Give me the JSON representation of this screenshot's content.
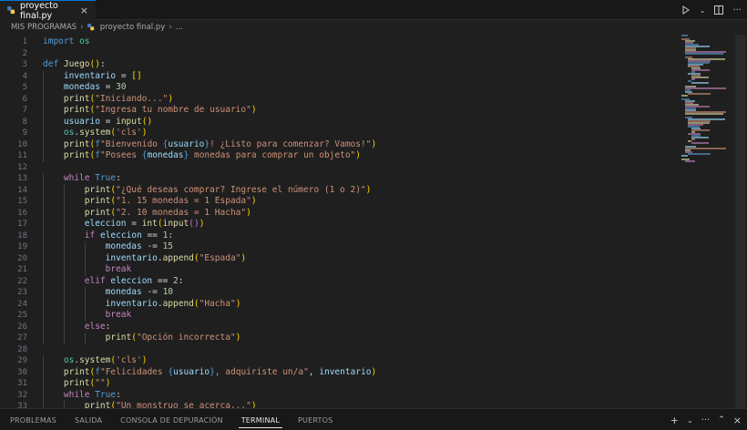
{
  "tab": {
    "filename": "proyecto final.py"
  },
  "breadcrumb": {
    "folder": "MIS PROGRAMAS",
    "file": "proyecto final.py",
    "more": "..."
  },
  "line_numbers": [
    "1",
    "2",
    "3",
    "4",
    "5",
    "6",
    "7",
    "8",
    "9",
    "10",
    "11",
    "12",
    "13",
    "14",
    "15",
    "16",
    "17",
    "18",
    "19",
    "20",
    "21",
    "22",
    "23",
    "24",
    "25",
    "26",
    "27",
    "28",
    "29",
    "30",
    "31",
    "32",
    "33"
  ],
  "code_lines": [
    "import os",
    "",
    "def Juego():",
    "    inventario = []",
    "    monedas = 30",
    "    print(\"Iniciando...\")",
    "    print(\"Ingresa tu nombre de usuario\")",
    "    usuario = input()",
    "    os.system('cls')",
    "    print(f\"Bienvenido {usuario}! ¿Listo para comenzar? Vamos!\")",
    "    print(f\"Posees {monedas} monedas para comprar un objeto\")",
    "",
    "    while True:",
    "        print(\"¿Qué deseas comprar? Ingrese el número (1 o 2)\")",
    "        print(\"1. 15 monedas = 1 Espada\")",
    "        print(\"2. 10 monedas = 1 Hacha\")",
    "        eleccion = int(input())",
    "        if eleccion == 1:",
    "            monedas -= 15",
    "            inventario.append(\"Espada\")",
    "            break",
    "        elif eleccion == 2:",
    "            monedas -= 10",
    "            inventario.append(\"Hacha\")",
    "            break",
    "        else:",
    "            print(\"Opción incorrecta\")",
    "",
    "    os.system('cls')",
    "    print(f\"Felicidades {usuario}, adquiriste un/a\", inventario)",
    "    print(\"\")",
    "    while True:",
    "        print(\"Un monstruo se acerca...\")"
  ],
  "panel": {
    "tabs": [
      "PROBLEMAS",
      "SALIDA",
      "CONSOLA DE DEPURACIÓN",
      "TERMINAL",
      "PUERTOS"
    ],
    "active_tab": "TERMINAL"
  },
  "icons": {
    "tab_file": "python-file-icon",
    "tab_close": "close-icon",
    "run": "run-icon",
    "split": "split-editor-icon",
    "more": "more-actions-icon",
    "new_terminal": "add-icon",
    "terminal_dropdown": "chevron-down-icon",
    "panel_more": "more-actions-icon",
    "maximize": "chevron-up-icon",
    "panel_close": "close-icon"
  },
  "colors": {
    "accent": "#0078d4",
    "background": "#1f1f1f"
  }
}
